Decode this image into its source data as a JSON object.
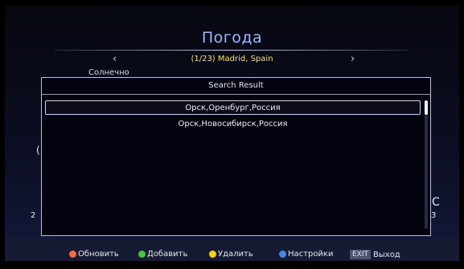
{
  "header": {
    "title": "Погода",
    "location": "(1/23) Madrid, Spain",
    "prev_arrow": "‹",
    "next_arrow": "›",
    "condition": "Солнечно"
  },
  "background": {
    "left_glyph": "(",
    "degree_unit": "°C",
    "left_number": "2",
    "right_number": "3"
  },
  "dialog": {
    "title": "Search Result",
    "results": [
      {
        "label": "Орск,Оренбург,Россия",
        "selected": true
      },
      {
        "label": "Орск,Новосибирск,Россия",
        "selected": false
      }
    ],
    "scroll_fraction": 0.0
  },
  "footer": {
    "red_label": "Обновить",
    "green_label": "Добавить",
    "yellow_label": "Удалить",
    "blue_label": "Настройки",
    "exit_key": "EXIT",
    "exit_label": "Выход",
    "colors": {
      "red": "#f26a4b",
      "green": "#4cc24a",
      "yellow": "#f2d21e",
      "blue": "#4a86e0"
    }
  }
}
